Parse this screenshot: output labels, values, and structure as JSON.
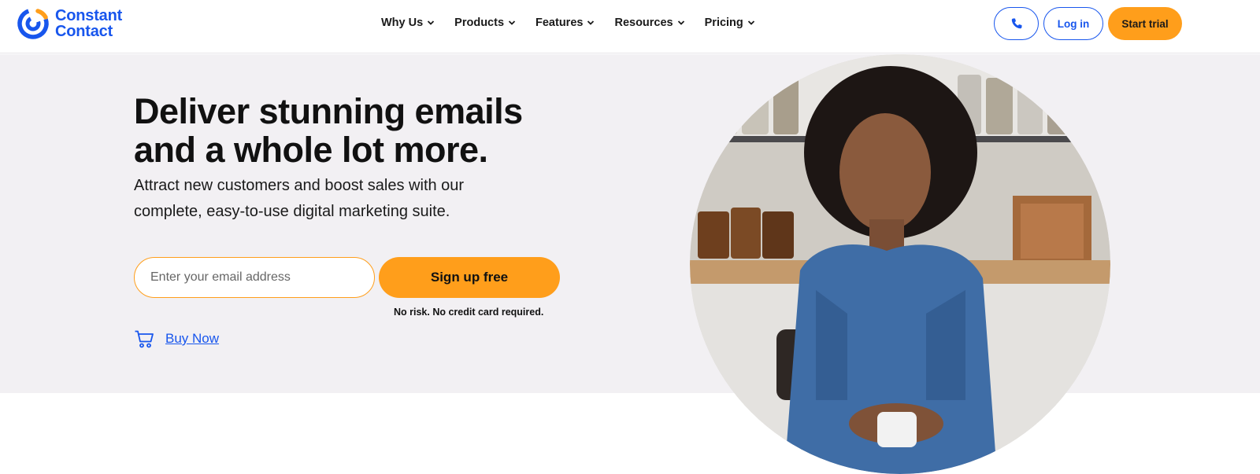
{
  "brand": {
    "line1": "Constant",
    "line2": "Contact",
    "color": "#1856ed",
    "accent": "#ff9e1b"
  },
  "nav": {
    "items": [
      {
        "label": "Why Us"
      },
      {
        "label": "Products"
      },
      {
        "label": "Features"
      },
      {
        "label": "Resources"
      },
      {
        "label": "Pricing"
      }
    ]
  },
  "header_actions": {
    "phone_icon": "phone-icon",
    "login_label": "Log in",
    "trial_label": "Start trial"
  },
  "hero": {
    "headline_line1": "Deliver stunning emails",
    "headline_line2": "and a whole lot more.",
    "subhead": "Attract new customers and boost sales with our complete, easy-to-use digital marketing suite.",
    "email_placeholder": "Enter your email address",
    "signup_label": "Sign up free",
    "disclaimer": "No risk. No credit card required.",
    "buy_label": "Buy Now",
    "buy_icon": "cart-icon",
    "photo_icon": "woman-portrait-photo"
  }
}
